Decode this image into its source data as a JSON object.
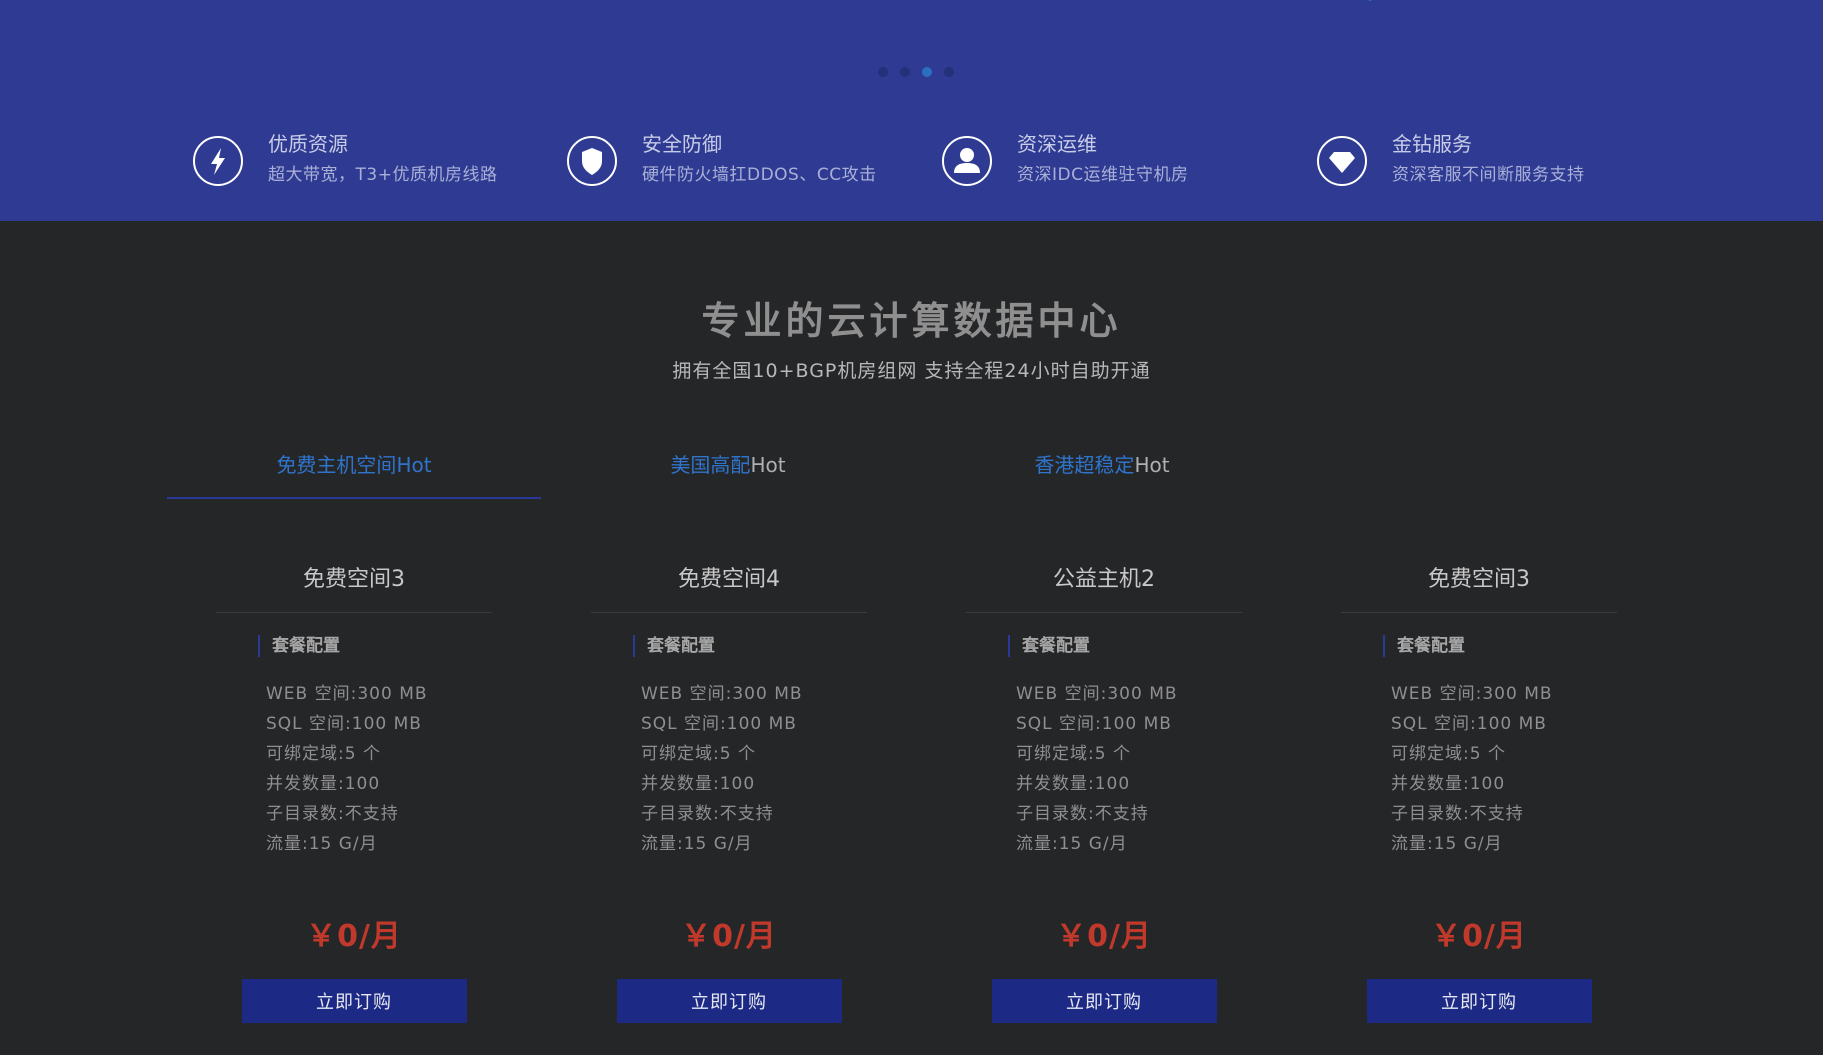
{
  "banner": {
    "dots": [
      {
        "active": false
      },
      {
        "active": false
      },
      {
        "active": true
      },
      {
        "active": false
      }
    ],
    "features": [
      {
        "icon": "lightning-icon",
        "title": "优质资源",
        "desc": "超大带宽，T3+优质机房线路"
      },
      {
        "icon": "shield-icon",
        "title": "安全防御",
        "desc": "硬件防火墙扛DDOS、CC攻击"
      },
      {
        "icon": "user-icon",
        "title": "资深运维",
        "desc": "资深IDC运维驻守机房"
      },
      {
        "icon": "diamond-icon",
        "title": "金钻服务",
        "desc": "资深客服不间断服务支持"
      }
    ]
  },
  "section": {
    "title": "专业的云计算数据中心",
    "subtitle": "拥有全国10+BGP机房组网 支持全程24小时自助开通"
  },
  "tabs": [
    {
      "label": "免费主机空间",
      "hot": "Hot",
      "active": true
    },
    {
      "label": "美国高配",
      "hot": "Hot",
      "active": false
    },
    {
      "label": "香港超稳定",
      "hot": "Hot",
      "active": false
    }
  ],
  "cards": [
    {
      "name": "免费空间3",
      "config_title": "套餐配置",
      "specs": [
        "WEB 空间:300 MB",
        "SQL 空间:100 MB",
        "可绑定域:5 个",
        "并发数量:100",
        "子目录数:不支持",
        "流量:15 G/月"
      ],
      "price": "￥0/月",
      "button": "立即订购"
    },
    {
      "name": "免费空间4",
      "config_title": "套餐配置",
      "specs": [
        "WEB 空间:300 MB",
        "SQL 空间:100 MB",
        "可绑定域:5 个",
        "并发数量:100",
        "子目录数:不支持",
        "流量:15 G/月"
      ],
      "price": "￥0/月",
      "button": "立即订购"
    },
    {
      "name": "公益主机2",
      "config_title": "套餐配置",
      "specs": [
        "WEB 空间:300 MB",
        "SQL 空间:100 MB",
        "可绑定域:5 个",
        "并发数量:100",
        "子目录数:不支持",
        "流量:15 G/月"
      ],
      "price": "￥0/月",
      "button": "立即订购"
    },
    {
      "name": "免费空间3",
      "config_title": "套餐配置",
      "specs": [
        "WEB 空间:300 MB",
        "SQL 空间:100 MB",
        "可绑定域:5 个",
        "并发数量:100",
        "子目录数:不支持",
        "流量:15 G/月"
      ],
      "price": "￥0/月",
      "button": "立即订购"
    }
  ],
  "colors": {
    "banner_bg": "#2f3b92",
    "page_bg": "#252628",
    "accent_blue": "#2f74cc",
    "price_red": "#c0392b",
    "button_bg": "#1d2a85"
  }
}
